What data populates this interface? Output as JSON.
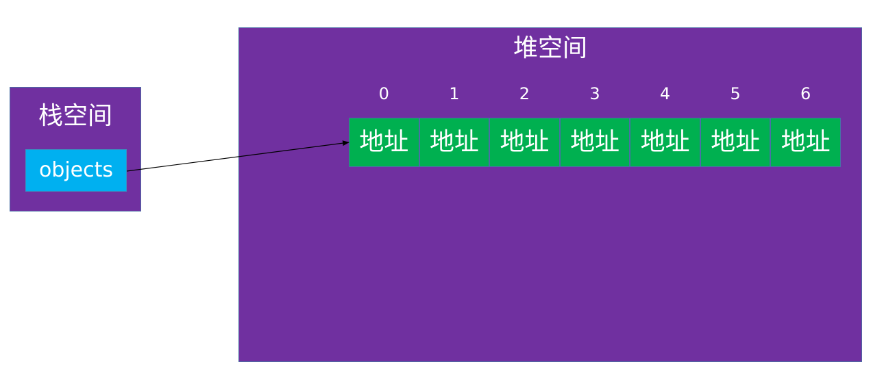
{
  "stack": {
    "title": "栈空间",
    "variable": "objects"
  },
  "heap": {
    "title": "堆空间",
    "indices": [
      "0",
      "1",
      "2",
      "3",
      "4",
      "5",
      "6"
    ],
    "cells": [
      "地址",
      "地址",
      "地址",
      "地址",
      "地址",
      "地址",
      "地址"
    ]
  },
  "colors": {
    "region_fill": "#7030a0",
    "variable_fill": "#00b0f0",
    "cell_fill": "#00b050",
    "border": "#4a6fa5",
    "text": "#ffffff",
    "arrow": "#000000"
  }
}
